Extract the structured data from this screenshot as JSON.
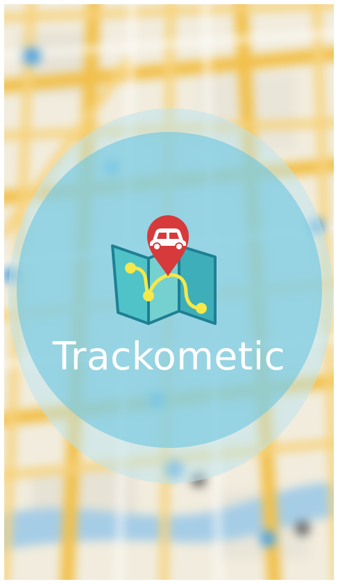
{
  "app": {
    "name": "Trackometic"
  },
  "icons": {
    "logo": "folded-map-with-route-and-car-pin-icon",
    "background": "map-background"
  },
  "colors": {
    "overlay_outer": "#bee4ec",
    "overlay_inner": "#70c6e0",
    "title_text": "#ffffff",
    "pin_red": "#d63a3b",
    "map_teal": "#4fc3c7",
    "route_yellow": "#f5e84a"
  }
}
